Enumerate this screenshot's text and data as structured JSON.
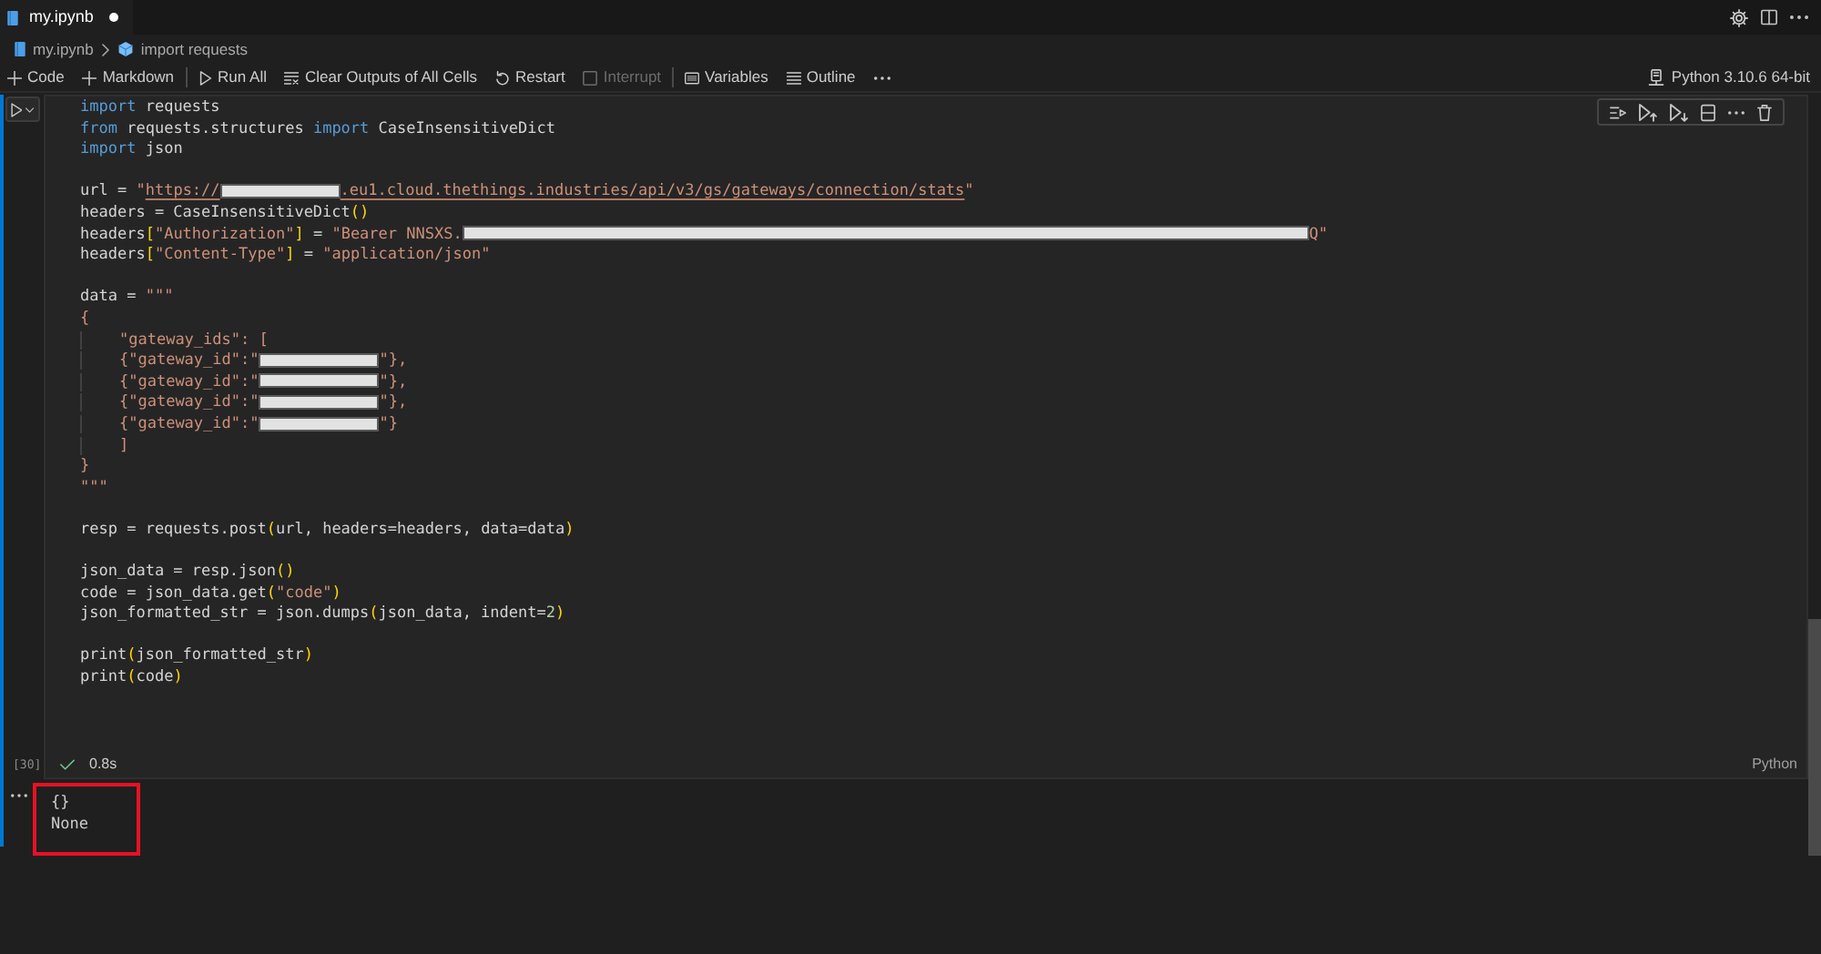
{
  "tabs": [
    {
      "label": "my.ipynb",
      "selected": true,
      "modified": true
    }
  ],
  "breadcrumb": [
    {
      "kind": "file",
      "label": "my.ipynb"
    },
    {
      "kind": "cell",
      "label": "import requests"
    }
  ],
  "toolbar": {
    "groups": [
      [
        {
          "kind": "add",
          "label": "Code",
          "disabled": false
        },
        {
          "kind": "add",
          "label": "Markdown",
          "disabled": false
        }
      ],
      [
        {
          "kind": "run_all",
          "label": "Run All",
          "disabled": false
        },
        {
          "kind": "clear",
          "label": "Clear Outputs of All Cells",
          "disabled": false
        },
        {
          "kind": "restart",
          "label": "Restart",
          "disabled": false
        },
        {
          "kind": "interrupt",
          "label": "Interrupt",
          "disabled": true
        }
      ],
      [
        {
          "kind": "variables",
          "label": "Variables",
          "disabled": false
        },
        {
          "kind": "outline",
          "label": "Outline",
          "disabled": false
        },
        {
          "kind": "more",
          "disabled": false
        }
      ]
    ]
  },
  "kernel": {
    "label": "Python 3.10.6 64-bit"
  },
  "cell": {
    "selected": true,
    "execution_count": "[30]",
    "succeeded": true,
    "duration": "0.8s",
    "language": "Python",
    "code_blocks": [
      [
        [
          {
            "kind": "keyword",
            "text": "import"
          },
          {
            "kind": "plain",
            "text": " requests"
          }
        ],
        [
          {
            "kind": "keyword",
            "text": "from"
          },
          {
            "kind": "plain",
            "text": " requests.structures "
          },
          {
            "kind": "keyword",
            "text": "import"
          },
          {
            "kind": "plain",
            "text": " CaseInsensitiveDict"
          }
        ],
        [
          {
            "kind": "keyword",
            "text": "import"
          },
          {
            "kind": "plain",
            "text": " json"
          }
        ]
      ],
      [
        [
          {
            "kind": "plain",
            "text": "url = "
          },
          {
            "kind": "string",
            "text": "\""
          },
          {
            "kind": "link",
            "text": "https://"
          },
          {
            "kind": "redacted"
          },
          {
            "kind": "link",
            "text": ".eu1.cloud.thethings.industries/api/v3/gs/gateways/connection/stats"
          },
          {
            "kind": "string",
            "text": "\""
          }
        ],
        [
          {
            "kind": "plain",
            "text": "headers = CaseInsensitiveDict"
          },
          {
            "kind": "bracket",
            "text": "()"
          }
        ],
        [
          {
            "kind": "plain",
            "text": "headers"
          },
          {
            "kind": "bracket",
            "text": "["
          },
          {
            "kind": "string",
            "text": "\"Authorization\""
          },
          {
            "kind": "bracket",
            "text": "]"
          },
          {
            "kind": "plain",
            "text": " = "
          },
          {
            "kind": "string",
            "text": "\"Bearer NNSXS."
          },
          {
            "kind": "redacted_long"
          },
          {
            "kind": "string",
            "text": "Q\""
          }
        ],
        [
          {
            "kind": "plain",
            "text": "headers"
          },
          {
            "kind": "bracket",
            "text": "["
          },
          {
            "kind": "string",
            "text": "\"Content-Type\""
          },
          {
            "kind": "bracket",
            "text": "]"
          },
          {
            "kind": "plain",
            "text": " = "
          },
          {
            "kind": "string",
            "text": "\"application/json\""
          }
        ]
      ],
      [
        [
          {
            "kind": "plain",
            "text": "data = "
          },
          {
            "kind": "string",
            "text": "\"\"\""
          }
        ],
        [
          {
            "kind": "string",
            "text": "{"
          }
        ],
        [
          {
            "kind": "string",
            "text": "    \"gateway_ids\": ["
          }
        ],
        [
          {
            "kind": "string",
            "text": "    {\"gateway_id\":\""
          },
          {
            "kind": "redacted"
          },
          {
            "kind": "string",
            "text": "\"},"
          }
        ],
        [
          {
            "kind": "string",
            "text": "    {\"gateway_id\":\""
          },
          {
            "kind": "redacted"
          },
          {
            "kind": "string",
            "text": "\"},"
          }
        ],
        [
          {
            "kind": "string",
            "text": "    {\"gateway_id\":\""
          },
          {
            "kind": "redacted"
          },
          {
            "kind": "string",
            "text": "\"},"
          }
        ],
        [
          {
            "kind": "string",
            "text": "    {\"gateway_id\":\""
          },
          {
            "kind": "redacted"
          },
          {
            "kind": "string",
            "text": "\"}"
          }
        ],
        [
          {
            "kind": "string",
            "text": "    ]"
          }
        ],
        [
          {
            "kind": "string",
            "text": "}"
          }
        ],
        [
          {
            "kind": "string",
            "text": "\"\"\""
          }
        ]
      ],
      [
        [
          {
            "kind": "plain",
            "text": "resp = requests.post"
          },
          {
            "kind": "bracket",
            "text": "("
          },
          {
            "kind": "plain",
            "text": "url, headers=headers, data=data"
          },
          {
            "kind": "bracket",
            "text": ")"
          }
        ]
      ],
      [
        [
          {
            "kind": "plain",
            "text": "json_data = resp.json"
          },
          {
            "kind": "bracket",
            "text": "()"
          }
        ],
        [
          {
            "kind": "plain",
            "text": "code = json_data.get"
          },
          {
            "kind": "bracket",
            "text": "("
          },
          {
            "kind": "string",
            "text": "\"code\""
          },
          {
            "kind": "bracket",
            "text": ")"
          }
        ],
        [
          {
            "kind": "plain",
            "text": "json_formatted_str = json.dumps"
          },
          {
            "kind": "bracket",
            "text": "("
          },
          {
            "kind": "plain",
            "text": "json_data, indent="
          },
          {
            "kind": "number",
            "text": "2"
          },
          {
            "kind": "bracket",
            "text": ")"
          }
        ]
      ],
      [
        [
          {
            "kind": "plain",
            "text": "print"
          },
          {
            "kind": "bracket",
            "text": "("
          },
          {
            "kind": "plain",
            "text": "json_formatted_str"
          },
          {
            "kind": "bracket",
            "text": ")"
          }
        ],
        [
          {
            "kind": "plain",
            "text": "print"
          },
          {
            "kind": "bracket",
            "text": "("
          },
          {
            "kind": "plain",
            "text": "code"
          },
          {
            "kind": "bracket",
            "text": ")"
          }
        ]
      ]
    ],
    "output": {
      "highlighted": true,
      "lines": [
        "{}",
        "None"
      ]
    }
  }
}
